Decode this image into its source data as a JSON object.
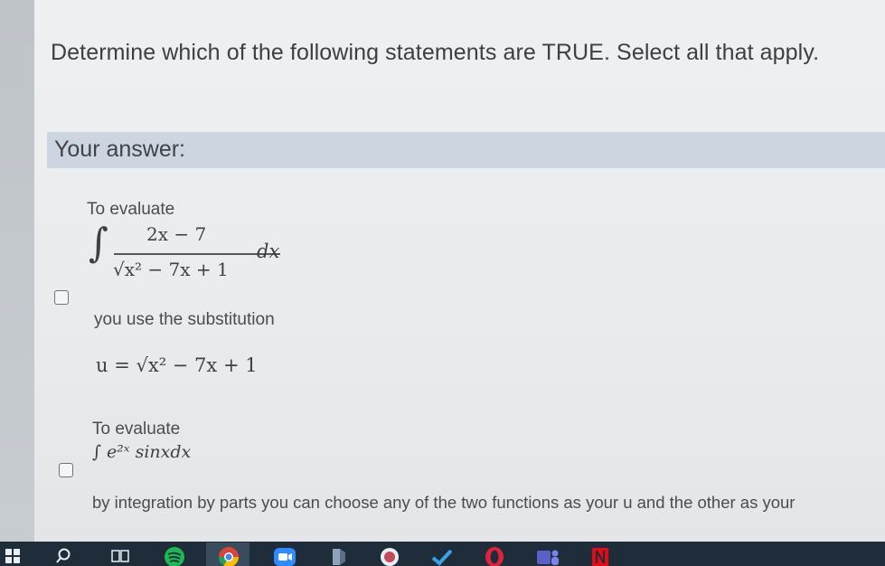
{
  "question": {
    "text": "Determine which of the following statements are TRUE. Select all that apply."
  },
  "answer": {
    "label": "Your answer:"
  },
  "options": [
    {
      "intro": "To evaluate",
      "numerator": "2x − 7",
      "denominator": "√x² − 7x + 1",
      "differential": "dx",
      "middle": "you use the substitution",
      "substitution": "u = √x² − 7x + 1",
      "checked": false
    },
    {
      "intro": "To evaluate",
      "integral": "∫ e²ˣ sinxdx",
      "description": "by integration by parts you can choose any of the two functions  as your u and the other as your",
      "checked": false
    }
  ],
  "taskbar": {
    "icons": [
      "windows-start-icon",
      "search-icon",
      "task-view-icon",
      "spotify-icon",
      "chrome-icon",
      "zoom-icon",
      "app-icon",
      "app-circle-icon",
      "check-app-icon",
      "opera-icon",
      "teams-icon",
      "netflix-icon"
    ],
    "colors": {
      "background": "#1f2c3a",
      "spotify": "#1db954",
      "chrome": "#4285f4",
      "zoom": "#2d8cff",
      "opera": "#e0233a",
      "teams": "#5b5fc7",
      "netflix": "#e50914"
    }
  }
}
